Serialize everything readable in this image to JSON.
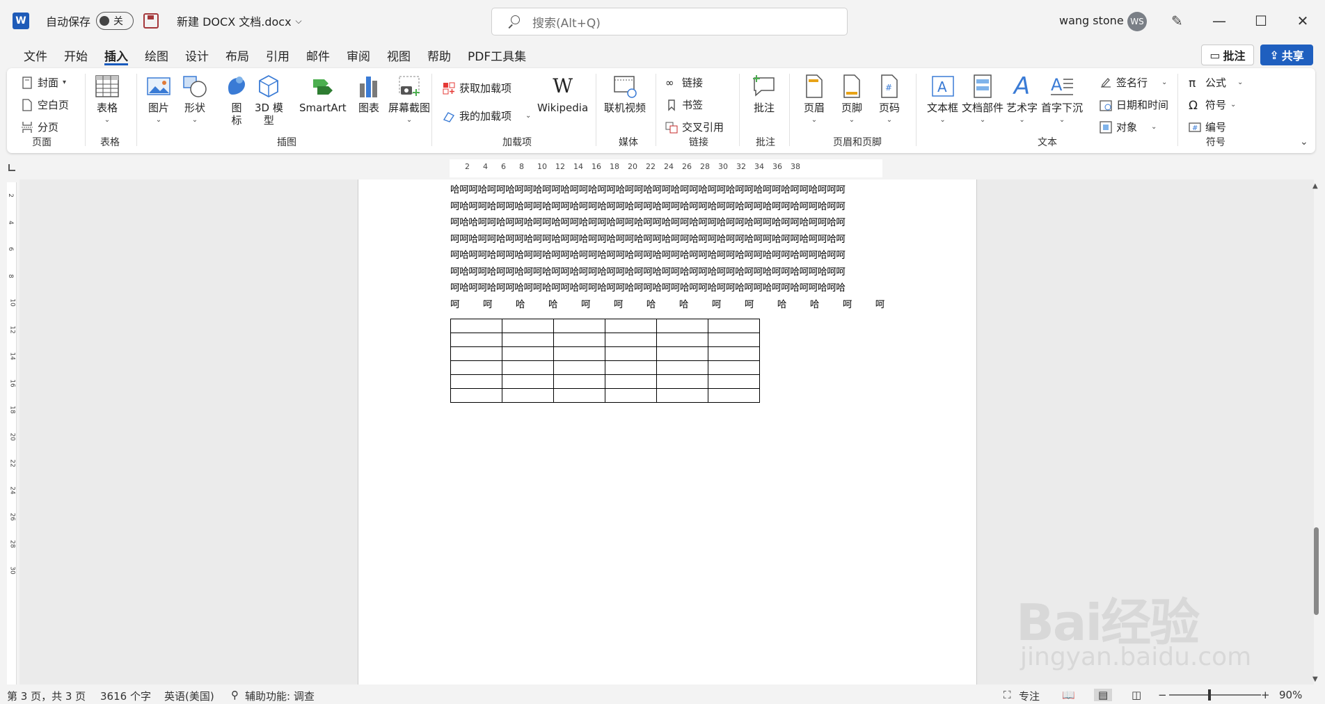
{
  "titlebar": {
    "app_logo": "W",
    "autosave_label": "自动保存",
    "autosave_state": "关",
    "doc_title": "新建 DOCX 文档.docx",
    "search_placeholder": "搜索(Alt+Q)",
    "user_name": "wang stone",
    "avatar_initials": "WS"
  },
  "tabs": [
    "文件",
    "开始",
    "插入",
    "绘图",
    "设计",
    "布局",
    "引用",
    "邮件",
    "审阅",
    "视图",
    "帮助",
    "PDF工具集"
  ],
  "active_tab": "插入",
  "header_buttons": {
    "comment": "批注",
    "share": "共享"
  },
  "ribbon": {
    "page_group": {
      "label": "页面",
      "items": [
        "封面",
        "空白页",
        "分页"
      ]
    },
    "table_group": {
      "label": "表格",
      "item": "表格"
    },
    "illustrations_group": {
      "label": "插图",
      "items": [
        "图片",
        "形状",
        "图\n标",
        "3D 模\n型",
        "SmartArt",
        "图表",
        "屏幕截图"
      ]
    },
    "addins_group": {
      "label": "加载项",
      "items": [
        "获取加载项",
        "我的加载项",
        "Wikipedia"
      ]
    },
    "media_group": {
      "label": "媒体",
      "item": "联机视频"
    },
    "links_group": {
      "label": "链接",
      "items": [
        "链接",
        "书签",
        "交叉引用"
      ]
    },
    "comments_group": {
      "label": "批注",
      "item": "批注"
    },
    "header_footer_group": {
      "label": "页眉和页脚",
      "items": [
        "页眉",
        "页脚",
        "页码"
      ]
    },
    "text_group": {
      "label": "文本",
      "items": [
        "文本框",
        "文档部件",
        "艺术字",
        "首字下沉",
        "签名行",
        "日期和时间",
        "对象"
      ]
    },
    "symbols_group": {
      "label": "符号",
      "items": [
        "公式",
        "符号",
        "编号"
      ]
    }
  },
  "ruler_ticks": [
    "2",
    "4",
    "6",
    "8",
    "10",
    "12",
    "14",
    "16",
    "18",
    "20",
    "22",
    "24",
    "26",
    "28",
    "30",
    "32",
    "34",
    "36",
    "38"
  ],
  "vruler_ticks": [
    "2",
    "4",
    "6",
    "8",
    "10",
    "12",
    "14",
    "16",
    "18",
    "20",
    "22",
    "24",
    "26",
    "28",
    "30"
  ],
  "document": {
    "lines": [
      "哈呵呵哈呵呵哈呵呵哈呵呵哈呵呵哈呵呵哈呵呵哈呵呵哈呵呵哈呵呵哈呵呵哈呵呵哈呵呵哈呵呵呵",
      "呵哈呵呵哈呵呵哈呵呵哈呵呵哈呵呵哈呵呵哈呵呵哈呵呵哈呵呵哈呵呵哈呵呵哈呵呵哈呵呵哈呵呵",
      "呵哈哈呵呵哈呵呵哈呵呵哈呵呵哈呵呵哈呵呵哈呵呵哈呵呵哈呵呵哈呵呵哈呵呵哈呵呵哈呵呵哈呵",
      "呵呵哈呵呵哈呵呵哈呵呵哈呵呵哈呵呵哈呵呵哈呵呵哈呵呵哈呵呵哈呵呵哈呵呵哈呵呵哈呵呵哈呵",
      "呵哈呵呵哈呵呵哈呵呵哈呵呵哈呵呵哈呵呵哈呵呵哈呵呵哈呵呵哈呵呵哈呵呵哈呵呵哈呵呵哈呵呵",
      "呵哈呵呵哈呵呵哈呵呵哈呵呵哈呵呵哈呵呵哈呵呵哈呵呵哈呵呵哈呵呵哈呵呵哈呵呵哈呵呵哈呵呵",
      "呵哈呵呵哈呵呵哈呵呵哈呵呵哈呵呵哈呵呵哈呵呵哈呵呵哈呵呵哈呵呵哈呵呵哈呵呵哈呵呵哈呵哈"
    ],
    "last_line_chars": [
      "呵",
      "呵",
      "哈",
      "哈",
      "呵",
      "呵",
      "哈",
      "哈",
      "呵",
      "呵",
      "哈",
      "哈",
      "呵",
      "呵"
    ],
    "table": {
      "rows": 6,
      "cols": 6
    }
  },
  "statusbar": {
    "page": "第 3 页，共 3 页",
    "words": "3616 个字",
    "language": "英语(美国)",
    "accessibility": "辅助功能: 调查",
    "focus": "专注",
    "zoom": "90%"
  },
  "watermark": {
    "brand": "Bai经验",
    "url": "jingyan.baidu.com"
  },
  "colors": {
    "accent": "#185abd",
    "share": "#1f5fbf",
    "word": "#1e5bb8"
  }
}
